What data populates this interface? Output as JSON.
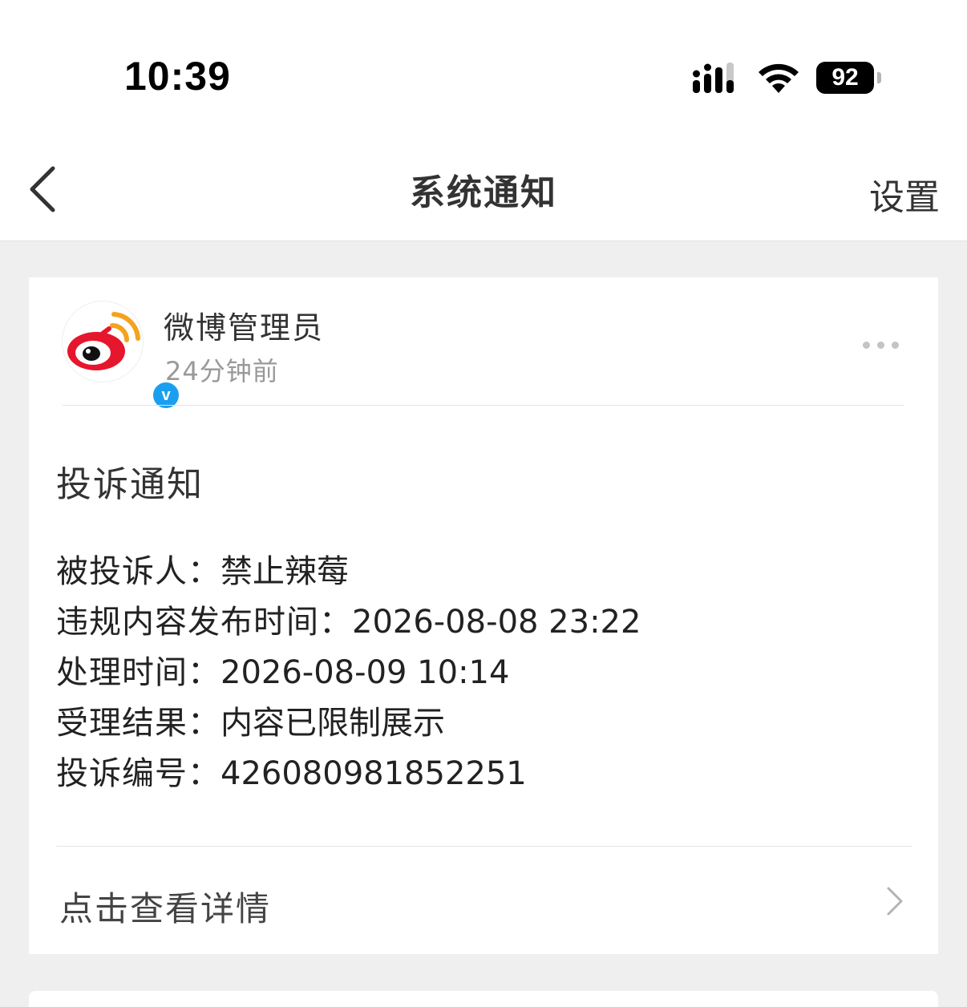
{
  "status_bar": {
    "time": "10:39",
    "battery": "92",
    "signal_icon": "cellular-signal-icon",
    "wifi_icon": "wifi-icon"
  },
  "nav": {
    "title": "系统通知",
    "settings_label": "设置",
    "back_icon": "chevron-left-icon"
  },
  "notification": {
    "sender_name": "微博管理员",
    "time_ago": "24分钟前",
    "verified_badge": "v",
    "title": "投诉通知",
    "details": [
      {
        "label": "被投诉人：",
        "value": "禁止辣莓"
      },
      {
        "label": "违规内容发布时间：",
        "value": "2026-08-08 23:22"
      },
      {
        "label": "处理时间：",
        "value": "2026-08-09 10:14"
      },
      {
        "label": "受理结果：",
        "value": "内容已限制展示"
      },
      {
        "label": "投诉编号：",
        "value": "426080981852251"
      }
    ],
    "view_details_label": "点击查看详情"
  },
  "colors": {
    "page_bg": "#efefef",
    "card_bg": "#ffffff",
    "verified_blue": "#1a9ff0",
    "weibo_red": "#e6162d",
    "weibo_orange": "#f4a31f"
  }
}
